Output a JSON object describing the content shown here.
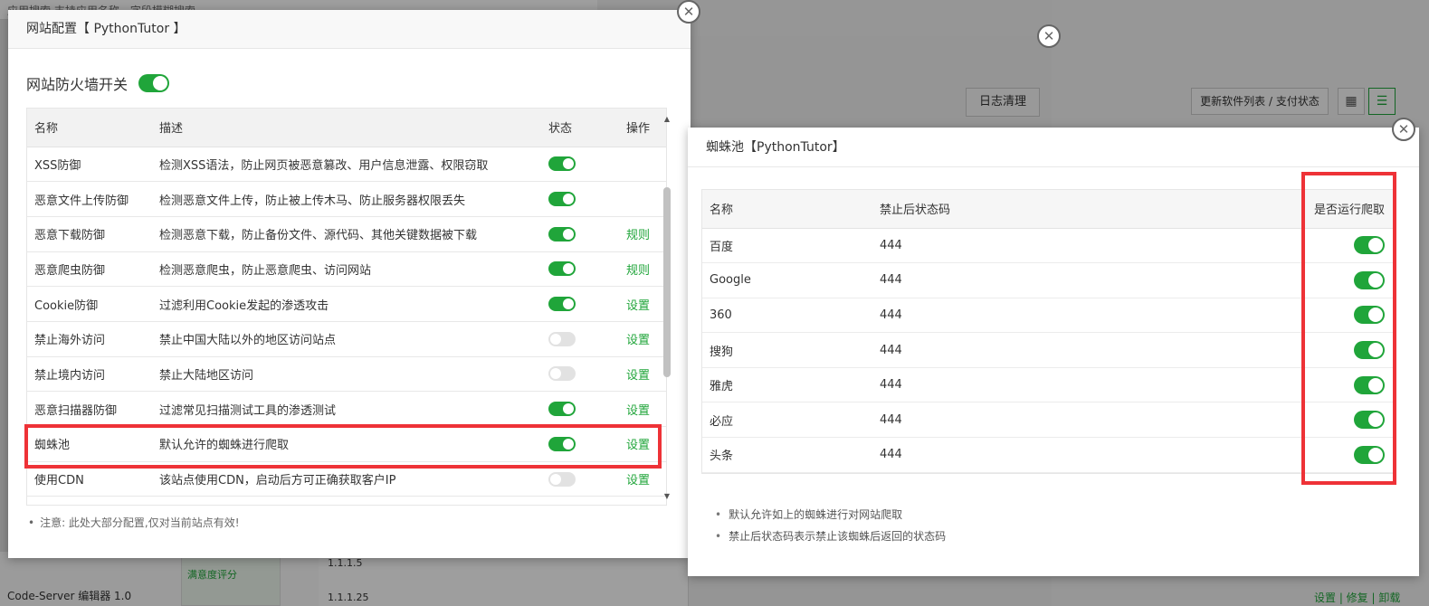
{
  "background": {
    "search_text": "应用搜索    支持应用名称、字段模糊搜索",
    "log_clean_button": "日志清理",
    "update_button": "更新软件列表 / 支付状态",
    "grid_view_icon": "grid-icon",
    "list_view_icon": "list-icon",
    "bottom_items": [
      "Code-Server 编辑器 1.0"
    ],
    "satisfaction": "满意度评分",
    "bottom_rows": [
      "1.1.1.5",
      "1.1.1.25"
    ],
    "bottom_actions": "设置 | 修复 | 卸载"
  },
  "firewall_dialog": {
    "title": "网站配置【 PythonTutor 】",
    "switch_label": "网站防火墙开关",
    "switch_on": true,
    "columns": [
      "名称",
      "描述",
      "状态",
      "操作"
    ],
    "rows": [
      {
        "name": "XSS防御",
        "desc": "检测XSS语法，防止网页被恶意篡改、用户信息泄露、权限窃取",
        "on": true,
        "action": ""
      },
      {
        "name": "恶意文件上传防御",
        "desc": "检测恶意文件上传，防止被上传木马、防止服务器权限丢失",
        "on": true,
        "action": ""
      },
      {
        "name": "恶意下载防御",
        "desc": "检测恶意下载，防止备份文件、源代码、其他关键数据被下载",
        "on": true,
        "action": "规则"
      },
      {
        "name": "恶意爬虫防御",
        "desc": "检测恶意爬虫，防止恶意爬虫、访问网站",
        "on": true,
        "action": "规则"
      },
      {
        "name": "Cookie防御",
        "desc": "过滤利用Cookie发起的渗透攻击",
        "on": true,
        "action": "设置"
      },
      {
        "name": "禁止海外访问",
        "desc": "禁止中国大陆以外的地区访问站点",
        "on": false,
        "action": "设置"
      },
      {
        "name": "禁止境内访问",
        "desc": "禁止大陆地区访问",
        "on": false,
        "action": "设置"
      },
      {
        "name": "恶意扫描器防御",
        "desc": "过滤常见扫描测试工具的渗透测试",
        "on": true,
        "action": "设置"
      },
      {
        "name": "蜘蛛池",
        "desc": "默认允许的蜘蛛进行爬取",
        "on": true,
        "action": "设置"
      },
      {
        "name": "使用CDN",
        "desc": "该站点使用CDN，启动后方可正确获取客户IP",
        "on": false,
        "action": "设置"
      }
    ],
    "note": "注意: 此处大部分配置,仅对当前站点有效!"
  },
  "spider_dialog": {
    "title": "蜘蛛池【PythonTutor】",
    "columns": [
      "名称",
      "禁止后状态码",
      "是否运行爬取"
    ],
    "rows": [
      {
        "name": "百度",
        "code": "444",
        "on": true
      },
      {
        "name": "Google",
        "code": "444",
        "on": true
      },
      {
        "name": "360",
        "code": "444",
        "on": true
      },
      {
        "name": "搜狗",
        "code": "444",
        "on": true
      },
      {
        "name": "雅虎",
        "code": "444",
        "on": true
      },
      {
        "name": "必应",
        "code": "444",
        "on": true
      },
      {
        "name": "头条",
        "code": "444",
        "on": true
      }
    ],
    "notes": [
      "默认允许如上的蜘蛛进行对网站爬取",
      "禁止后状态码表示禁止该蜘蛛后返回的状态码"
    ]
  },
  "colors": {
    "accent": "#20a53a",
    "highlight": "#ee3237"
  }
}
